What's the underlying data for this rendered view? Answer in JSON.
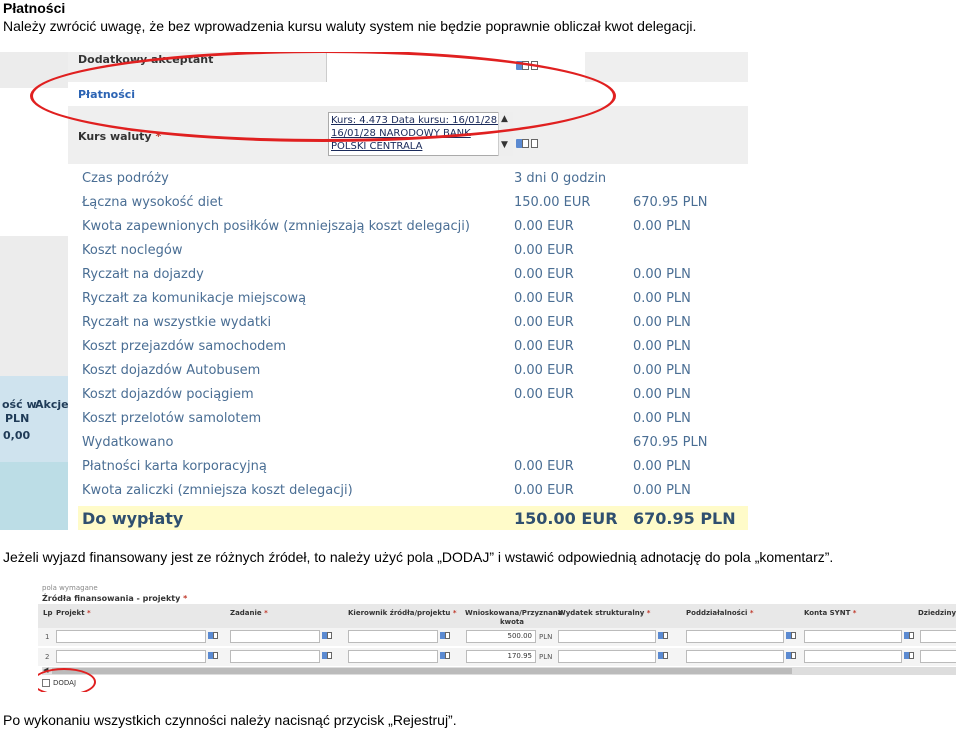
{
  "doc": {
    "title": "Płatności",
    "p1": "Należy zwrócić uwagę, że bez wprowadzenia kursu waluty system nie będzie poprawnie obliczał kwot delegacji.",
    "p2": "Jeżeli wyjazd finansowany jest ze różnych źródeł, to należy użyć pola „DODAJ” i wstawić odpowiednią adnotację do pola „komentarz”.",
    "p3": "Po wykonaniu wszystkich czynności należy nacisnąć przycisk „Rejestruj”."
  },
  "shot1": {
    "left_strip": {
      "akcje": "Akcje",
      "osc_w": "ość w",
      "pln": "PLN",
      "value": "0,00"
    },
    "dodatkowy_label": "Dodatkowy akceptant",
    "platnosci_label": "Płatności",
    "kurs_label": "Kurs waluty",
    "required_mark": "*",
    "kurs_option_line1": "Kurs: 4.473 Data kursu: 16/01/28 -",
    "kurs_option_line2": "16/01/28 NARODOWY BANK",
    "kurs_option_line3": "POLSKI CENTRALA",
    "rows": [
      {
        "label": "Czas podróży",
        "eur": "3 dni 0 godzin",
        "pln": ""
      },
      {
        "label": "Łączna wysokość diet",
        "eur": "150.00 EUR",
        "pln": "670.95 PLN"
      },
      {
        "label": "Kwota zapewnionych posiłków (zmniejszają koszt delegacji)",
        "eur": "0.00 EUR",
        "pln": "0.00 PLN"
      },
      {
        "label": "Koszt noclegów",
        "eur": "0.00 EUR",
        "pln": ""
      },
      {
        "label": "Ryczałt na dojazdy",
        "eur": "0.00 EUR",
        "pln": "0.00 PLN"
      },
      {
        "label": "Ryczałt za komunikacje miejscową",
        "eur": "0.00 EUR",
        "pln": "0.00 PLN"
      },
      {
        "label": "Ryczałt na wszystkie wydatki",
        "eur": "0.00 EUR",
        "pln": "0.00 PLN"
      },
      {
        "label": "Koszt przejazdów samochodem",
        "eur": "0.00 EUR",
        "pln": "0.00 PLN"
      },
      {
        "label": "Koszt dojazdów Autobusem",
        "eur": "0.00 EUR",
        "pln": "0.00 PLN"
      },
      {
        "label": "Koszt dojazdów pociągiem",
        "eur": "0.00 EUR",
        "pln": "0.00 PLN"
      },
      {
        "label": "Koszt przelotów samolotem",
        "eur": "",
        "pln": "0.00 PLN"
      },
      {
        "label": "Wydatkowano",
        "eur": "",
        "pln": "670.95 PLN"
      },
      {
        "label": "Płatności karta korporacyjną",
        "eur": "0.00 EUR",
        "pln": "0.00 PLN"
      },
      {
        "label": "Kwota zaliczki (zmniejsza koszt delegacji)",
        "eur": "0.00 EUR",
        "pln": "0.00 PLN"
      }
    ],
    "total": {
      "label": "Do wypłaty",
      "eur": "150.00 EUR",
      "pln": "670.95 PLN"
    }
  },
  "shot2": {
    "top_label": "pola wymagane",
    "section": "Źródła finansowania - projekty",
    "headers": {
      "lp": "Lp",
      "projekt": "Projekt",
      "zadanie": "Zadanie",
      "kierownik": "Kierownik źródła/projektu",
      "wnioskowana": "Wnioskowana/Przyznana kwota",
      "wydatek": "Wydatek strukturalny",
      "poddzialalnosci": "Poddziałalności",
      "konta": "Konta SYNT",
      "dziedziny": "Dziedziny"
    },
    "required_mark": "*",
    "rows": [
      {
        "lp": "1",
        "amount": "500.00",
        "currency": "PLN"
      },
      {
        "lp": "2",
        "amount": "170.95",
        "currency": "PLN"
      }
    ],
    "add_label": "DODAJ"
  }
}
